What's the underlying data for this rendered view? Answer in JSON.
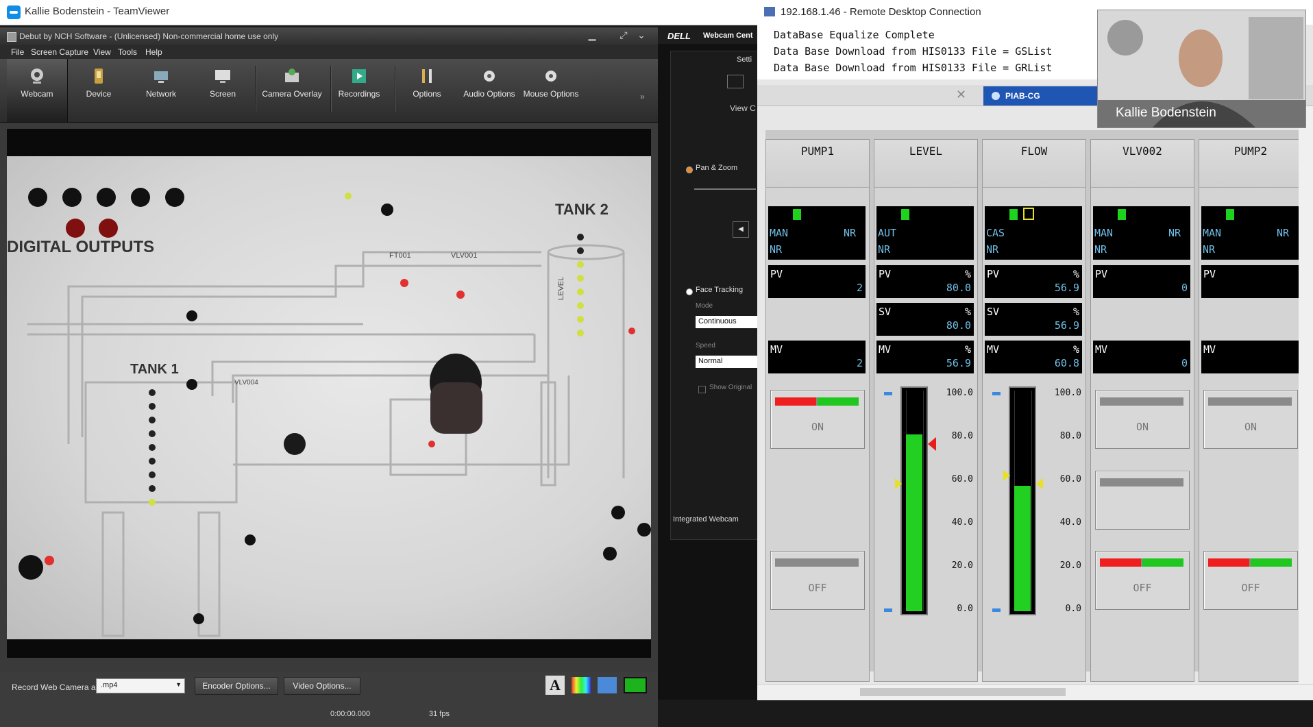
{
  "teamviewer": {
    "title": "Kallie Bodenstein - TeamViewer"
  },
  "debut": {
    "title": "Debut by NCH Software - (Unlicensed) Non-commercial home use only",
    "menu": [
      "File",
      "Screen Capture",
      "View",
      "Tools",
      "Help"
    ],
    "toolbar": [
      {
        "label": "Webcam",
        "icon": "webcam-icon"
      },
      {
        "label": "Device",
        "icon": "device-icon"
      },
      {
        "label": "Network",
        "icon": "network-icon"
      },
      {
        "label": "Screen",
        "icon": "screen-icon"
      },
      {
        "label": "Camera Overlay",
        "icon": "camera-overlay-icon"
      },
      {
        "label": "Recordings",
        "icon": "recordings-icon"
      },
      {
        "label": "Options",
        "icon": "options-icon"
      },
      {
        "label": "Audio Options",
        "icon": "audio-options-icon"
      },
      {
        "label": "Mouse Options",
        "icon": "mouse-options-icon"
      }
    ],
    "record_label": "Record Web Camera as:",
    "format": ".mp4",
    "encoder_button": "Encoder Options...",
    "video_button": "Video Options...",
    "time": "0:00:00.000",
    "fps": "31 fps"
  },
  "camera_view": {
    "digital_outputs": "DIGITAL OUTPUTS",
    "tank1": "TANK 1",
    "tank2": "TANK 2",
    "ft001": "FT001",
    "vlv001": "VLV001",
    "vlv004": "VLV004",
    "level": "LEVEL"
  },
  "dell": {
    "logo": "DELL",
    "title": "Webcam Cent",
    "settings": "Setti",
    "view": "View C",
    "pan_zoom": "Pan & Zoom",
    "face_tracking": "Face Tracking",
    "mode_label": "Mode",
    "mode_value": "Continuous",
    "speed_label": "Speed",
    "speed_value": "Normal",
    "show_original": "Show Original",
    "device": "Integrated Webcam"
  },
  "rdc": {
    "title": "192.168.1.46 - Remote Desktop Connection",
    "console": [
      "DataBase Equalize Complete",
      "Data Base Download from HIS0133 File = GSList",
      "Data Base Download from HIS0133 File = GRList"
    ],
    "tab": "PIAB-CG"
  },
  "faceplates": [
    {
      "tag": "PUMP1",
      "mode": "MAN",
      "nr": "NR",
      "nr2": "NR",
      "pv": "2",
      "mv": "2",
      "type": "motor",
      "on_active": true,
      "off_active": false
    },
    {
      "tag": "LEVEL",
      "mode": "AUT",
      "nr": "",
      "nr2": "NR",
      "pv": "80.0",
      "sv": "80.0",
      "mv": "56.9",
      "type": "pid",
      "pv_fill_pct": 80.0
    },
    {
      "tag": "FLOW",
      "mode": "CAS",
      "nr": "",
      "nr2": "NR",
      "pv": "56.9",
      "sv": "56.9",
      "mv": "60.8",
      "type": "pid",
      "pv_fill_pct": 56.9
    },
    {
      "tag": "VLV002",
      "mode": "MAN",
      "nr": "NR",
      "nr2": "NR",
      "pv": "0",
      "mv": "0",
      "type": "valve",
      "on_active": false,
      "off_active": true
    },
    {
      "tag": "PUMP2",
      "mode": "MAN",
      "nr": "NR",
      "nr2": "NR",
      "pv": "",
      "mv": "",
      "type": "motor",
      "on_active": false,
      "off_active": true
    }
  ],
  "labels": {
    "pv": "PV",
    "sv": "SV",
    "mv": "MV",
    "pct": "%",
    "on": "ON",
    "off": "OFF"
  },
  "scale_ticks": [
    "100.0",
    "80.0",
    "60.0",
    "40.0",
    "20.0",
    "0.0"
  ],
  "video_overlay": {
    "name": "Kallie Bodenstein"
  }
}
